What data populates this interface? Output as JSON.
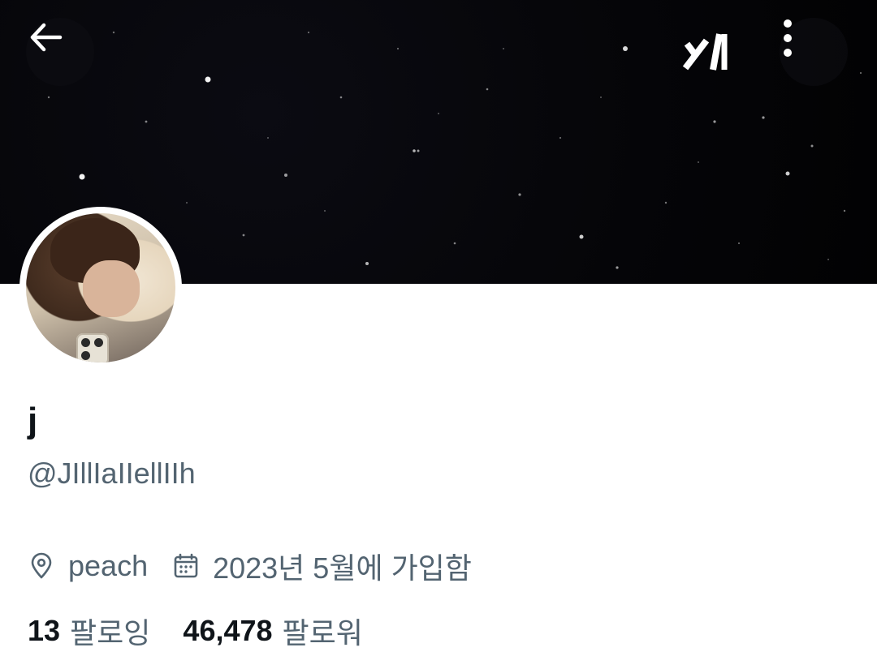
{
  "header": {
    "back_icon": "arrow-left-icon",
    "grok_icon": "grok-logo-icon",
    "more_icon": "more-vertical-icon"
  },
  "profile": {
    "display_name": "j",
    "handle": "@JIllIaIIellIIh",
    "location": "peach",
    "joined": "2023년 5월에 가입함",
    "following_count": "13",
    "following_label": "팔로잉",
    "followers_count": "46,478",
    "followers_label": "팔로워"
  },
  "colors": {
    "text_primary": "#0f1419",
    "text_secondary": "#536471",
    "banner": "#050508"
  }
}
